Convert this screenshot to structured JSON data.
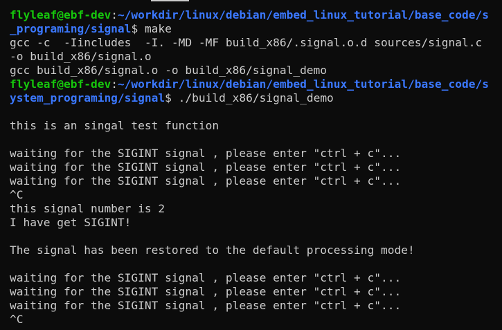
{
  "terminal": {
    "lines": [
      {
        "type": "prompt",
        "user": "flyleaf@ebf-dev",
        "sep": ":",
        "path": "~/workdir/linux/debian/embed_linux_tutorial/base_code/s"
      },
      {
        "type": "prompt-cont",
        "path": "_programing/signal",
        "sym": "$ ",
        "cmd": "make"
      },
      {
        "type": "out",
        "text": "gcc -c  -Iincludes  -I. -MD -MF build_x86/.signal.o.d sources/signal.c"
      },
      {
        "type": "out",
        "text": "-o build_x86/signal.o"
      },
      {
        "type": "out",
        "text": "gcc build_x86/signal.o -o build_x86/signal_demo"
      },
      {
        "type": "prompt",
        "user": "flyleaf@ebf-dev",
        "sep": ":",
        "path": "~/workdir/linux/debian/embed_linux_tutorial/base_code/s"
      },
      {
        "type": "prompt-cont",
        "path": "ystem_programing/signal",
        "sym": "$ ",
        "cmd": "./build_x86/signal_demo"
      },
      {
        "type": "out",
        "text": ""
      },
      {
        "type": "out",
        "text": "this is an singal test function"
      },
      {
        "type": "out",
        "text": ""
      },
      {
        "type": "out",
        "text": "waiting for the SIGINT signal , please enter \"ctrl + c\"..."
      },
      {
        "type": "out",
        "text": "waiting for the SIGINT signal , please enter \"ctrl + c\"..."
      },
      {
        "type": "out",
        "text": "waiting for the SIGINT signal , please enter \"ctrl + c\"..."
      },
      {
        "type": "out",
        "text": "^C"
      },
      {
        "type": "out",
        "text": "this signal number is 2"
      },
      {
        "type": "out",
        "text": "I have get SIGINT!"
      },
      {
        "type": "out",
        "text": ""
      },
      {
        "type": "out",
        "text": "The signal has been restored to the default processing mode!"
      },
      {
        "type": "out",
        "text": ""
      },
      {
        "type": "out",
        "text": "waiting for the SIGINT signal , please enter \"ctrl + c\"..."
      },
      {
        "type": "out",
        "text": "waiting for the SIGINT signal , please enter \"ctrl + c\"..."
      },
      {
        "type": "out",
        "text": "waiting for the SIGINT signal , please enter \"ctrl + c\"..."
      },
      {
        "type": "out",
        "text": "^C"
      }
    ]
  },
  "colors": {
    "background": "#0c0c0c",
    "foreground": "#cccccc",
    "prompt_user": "#16c60c",
    "prompt_path": "#3b78ff"
  }
}
